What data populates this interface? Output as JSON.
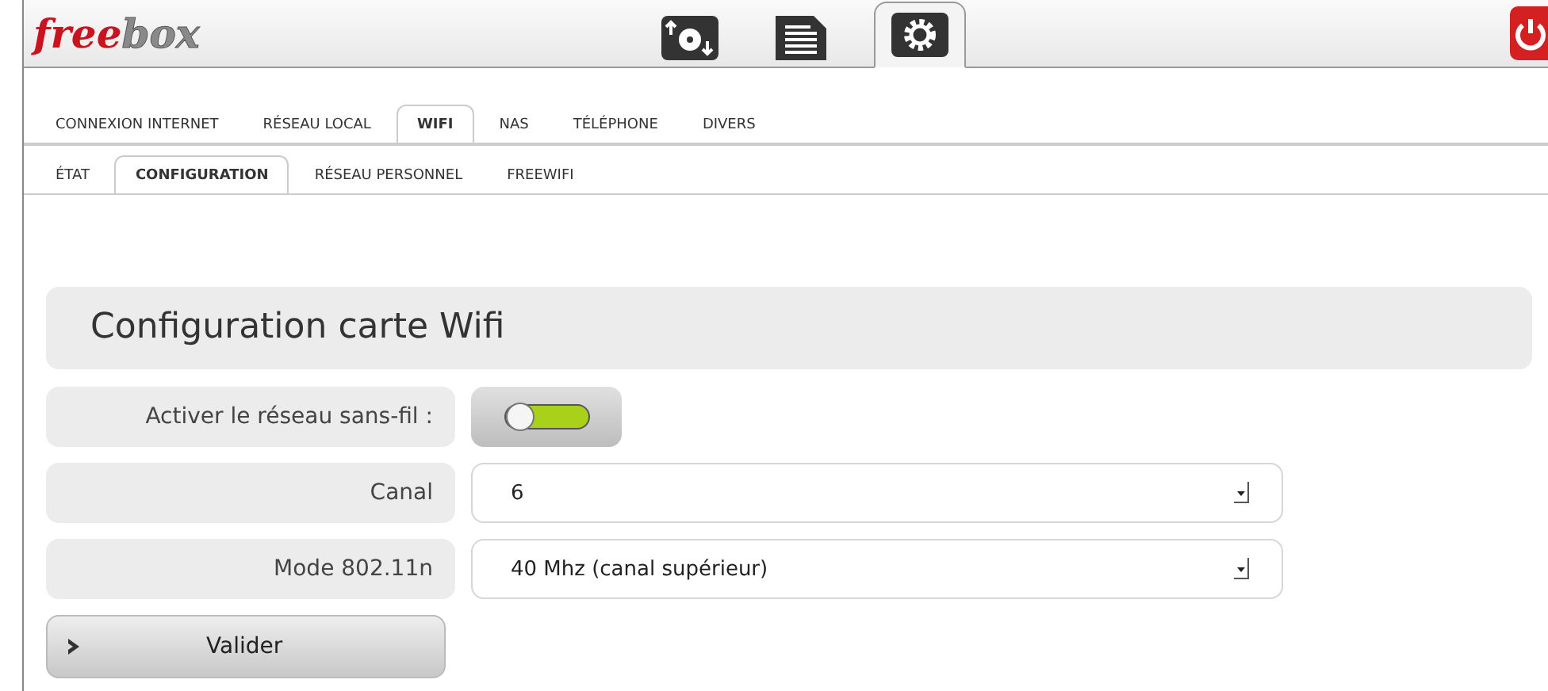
{
  "logo": {
    "part1": "free",
    "part2": "box"
  },
  "toolbar": [
    {
      "kind": "transfer",
      "selected": false
    },
    {
      "kind": "list",
      "selected": false
    },
    {
      "kind": "settings",
      "selected": true
    }
  ],
  "tabs": [
    {
      "label": "CONNEXION INTERNET",
      "selected": false
    },
    {
      "label": "RÉSEAU LOCAL",
      "selected": false
    },
    {
      "label": "WIFI",
      "selected": true
    },
    {
      "label": "NAS",
      "selected": false
    },
    {
      "label": "TÉLÉPHONE",
      "selected": false
    },
    {
      "label": "DIVERS",
      "selected": false
    }
  ],
  "subtabs": [
    {
      "label": "ÉTAT",
      "selected": false
    },
    {
      "label": "CONFIGURATION",
      "selected": true
    },
    {
      "label": "RÉSEAU PERSONNEL",
      "selected": false
    },
    {
      "label": "FREEWIFI",
      "selected": false
    }
  ],
  "panel": {
    "title": "Configuration carte Wifi",
    "fields": [
      {
        "kind": "toggle",
        "label": "Activer le réseau sans-fil :",
        "on": true
      },
      {
        "kind": "select",
        "label": "Canal",
        "value": "6"
      },
      {
        "kind": "select",
        "label": "Mode 802.11n",
        "value": "40 Mhz (canal supérieur)"
      }
    ],
    "submit": "Valider"
  }
}
